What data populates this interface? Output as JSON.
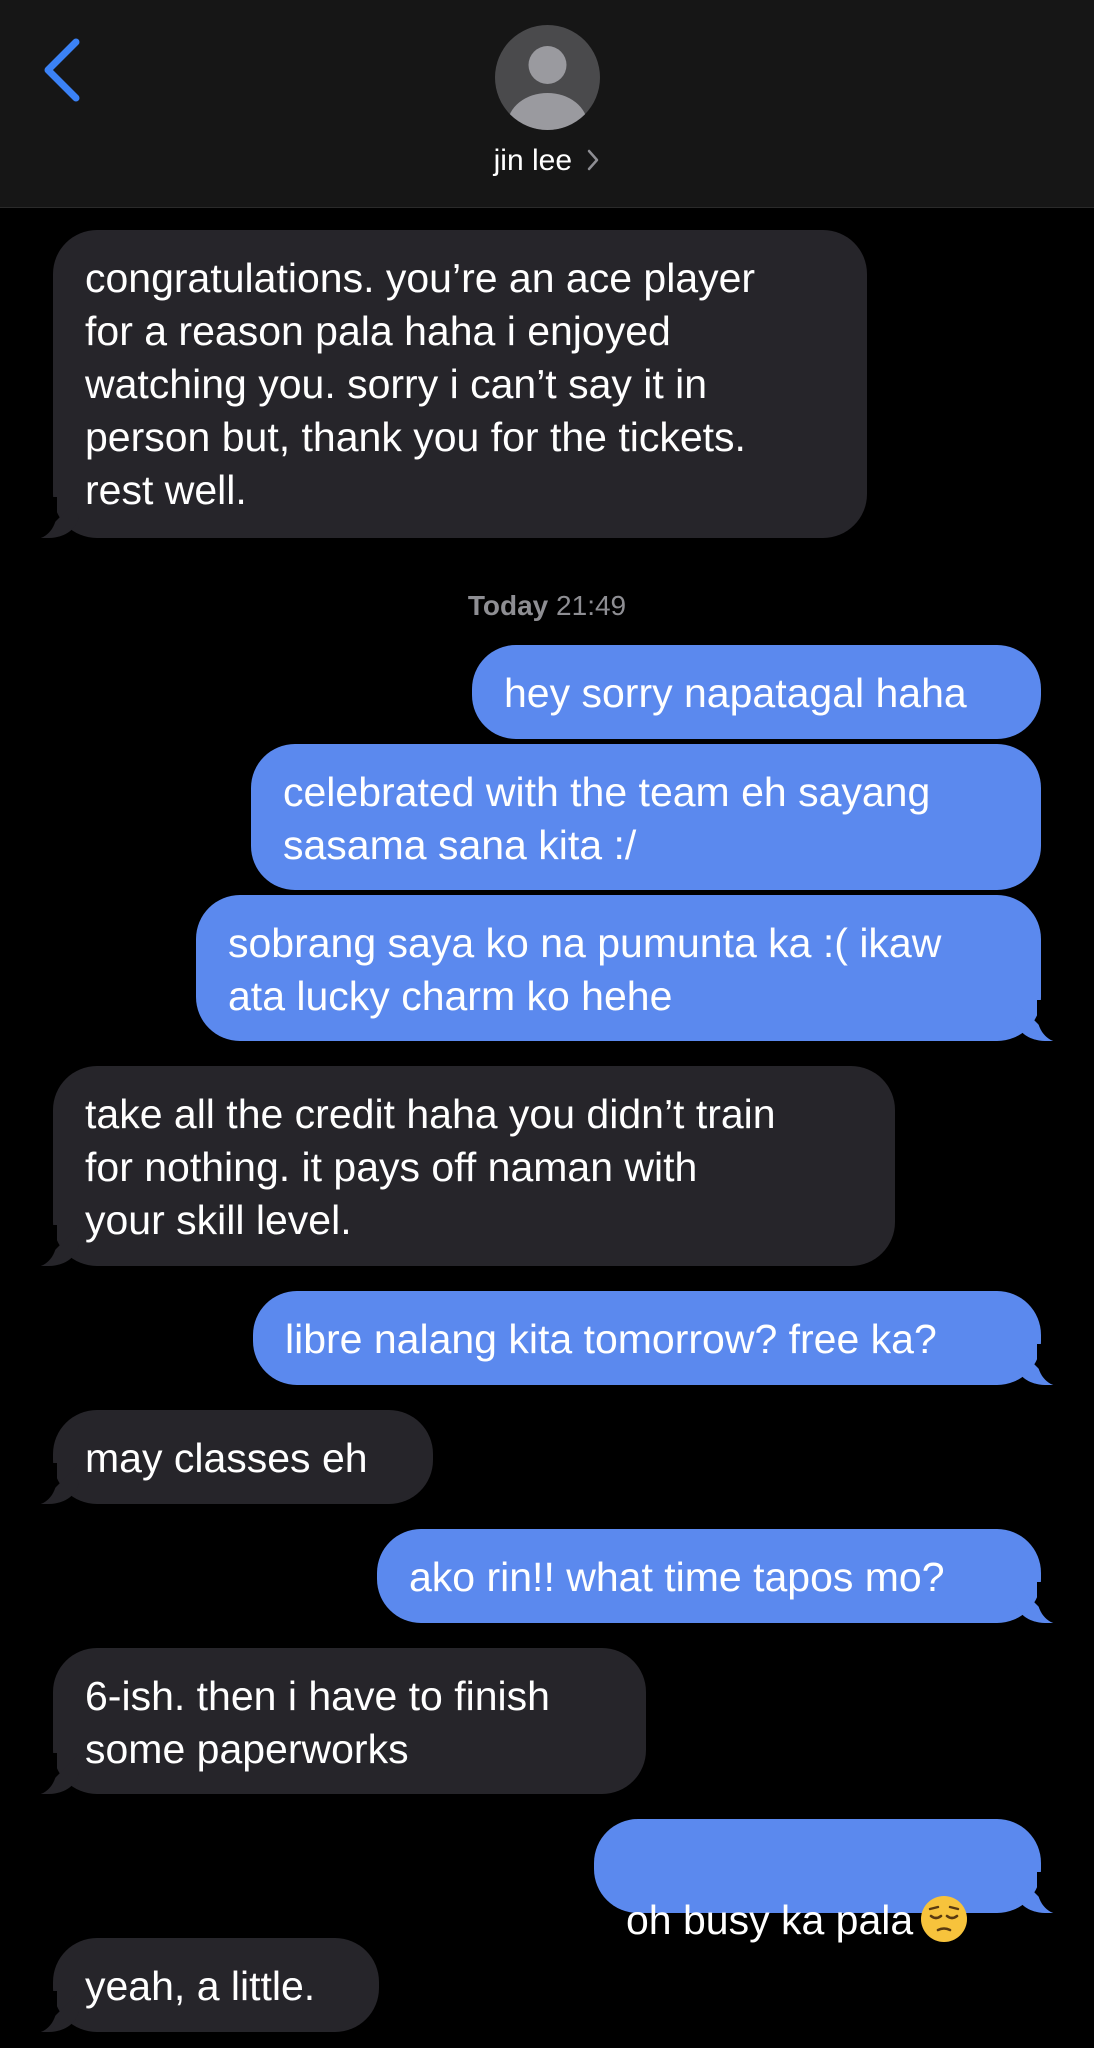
{
  "header": {
    "contact_name": "jin lee",
    "back_icon": "chevron-left-icon",
    "avatar_icon": "person-silhouette-icon",
    "chevron_icon": "chevron-right-icon"
  },
  "colors": {
    "accent": "#3b82f6",
    "outgoing_bubble": "#5b89ee",
    "incoming_bubble": "#26252a",
    "background": "#000000",
    "header": "#161616"
  },
  "timestamp": {
    "day": "Today",
    "time": "21:49"
  },
  "messages": [
    {
      "direction": "incoming",
      "text": "congratulations. you’re an ace player\nfor a reason pala haha i enjoyed\nwatching you. sorry i can’t say it in\nperson but, thank you for the tickets.\nrest well."
    },
    {
      "direction": "outgoing",
      "text": "hey sorry napatagal haha"
    },
    {
      "direction": "outgoing",
      "text": "celebrated with the team eh sayang\nsasama sana kita :/"
    },
    {
      "direction": "outgoing",
      "text": "sobrang saya ko na pumunta ka :( ikaw\nata lucky charm ko hehe"
    },
    {
      "direction": "incoming",
      "text": "take all the credit haha you didn’t train\nfor nothing. it pays off naman with\nyour skill level."
    },
    {
      "direction": "outgoing",
      "text": "libre nalang kita tomorrow? free ka?"
    },
    {
      "direction": "incoming",
      "text": "may classes eh"
    },
    {
      "direction": "outgoing",
      "text": "ako rin!! what time tapos mo?"
    },
    {
      "direction": "incoming",
      "text": "6-ish. then i have to finish\nsome paperworks"
    },
    {
      "direction": "outgoing",
      "text": "oh busy ka pala",
      "emoji": "pensive-face-emoji"
    },
    {
      "direction": "incoming",
      "text": "yeah, a little."
    }
  ]
}
